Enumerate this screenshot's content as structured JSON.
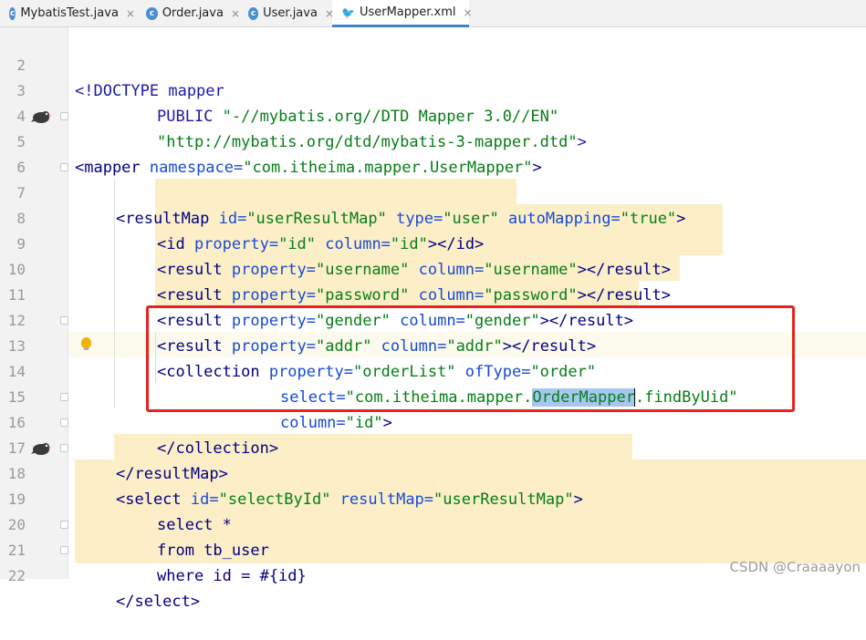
{
  "tabs": [
    {
      "label": "MybatisTest.java",
      "icon": "java-class-icon",
      "active": false
    },
    {
      "label": "Order.java",
      "icon": "java-class-icon",
      "active": false
    },
    {
      "label": "User.java",
      "icon": "java-class-icon",
      "active": false
    },
    {
      "label": "UserMapper.xml",
      "icon": "mybatis-xml-icon",
      "active": true
    }
  ],
  "close_glyph": "×",
  "line_numbers": [
    "2",
    "3",
    "4",
    "5",
    "6",
    "7",
    "8",
    "9",
    "10",
    "11",
    "12",
    "13",
    "14",
    "15",
    "16",
    "17",
    "18",
    "19",
    "20",
    "21",
    "22"
  ],
  "code": {
    "l2": {
      "open": "<!DOCTYPE mapper"
    },
    "l3": {
      "kw": "PUBLIC ",
      "val": "\"-//mybatis.org//DTD Mapper 3.0//EN\""
    },
    "l4": {
      "val": "\"http://mybatis.org/dtd/mybatis-3-mapper.dtd\"",
      "close": ">"
    },
    "l5": {
      "tag": "<mapper ",
      "a1": "namespace=",
      "v1": "\"com.itheima.mapper.UserMapper\"",
      "close": ">"
    },
    "l7": {
      "tag": "<resultMap ",
      "a1": "id=",
      "v1": "\"userResultMap\" ",
      "a2": "type=",
      "v2": "\"user\" ",
      "a3": "autoMapping=",
      "v3": "\"true\"",
      "close": ">"
    },
    "l8": {
      "tag": "<id ",
      "a1": "property=",
      "v1": "\"id\" ",
      "a2": "column=",
      "v2": "\"id\"",
      "close": "></id>"
    },
    "l9": {
      "tag": "<result ",
      "a1": "property=",
      "v1": "\"username\" ",
      "a2": "column=",
      "v2": "\"username\"",
      "close": "></result>"
    },
    "l10": {
      "tag": "<result ",
      "a1": "property=",
      "v1": "\"password\" ",
      "a2": "column=",
      "v2": "\"password\"",
      "close": "></result>"
    },
    "l11": {
      "tag": "<result ",
      "a1": "property=",
      "v1": "\"gender\" ",
      "a2": "column=",
      "v2": "\"gender\"",
      "close": "></result>"
    },
    "l12": {
      "tag": "<result ",
      "a1": "property=",
      "v1": "\"addr\" ",
      "a2": "column=",
      "v2": "\"addr\"",
      "close": "></result>"
    },
    "l13": {
      "tag": "<collection ",
      "a1": "property=",
      "v1": "\"orderList\" ",
      "a2": "ofType=",
      "v2": "\"order\""
    },
    "l14": {
      "a1": "select=",
      "v1a": "\"com.itheima.mapper.",
      "v1sel": "OrderMapper",
      "v1b": ".findByUid\""
    },
    "l15": {
      "a1": "column=",
      "v1": "\"id\"",
      "close": ">"
    },
    "l16": {
      "close": "</collection>"
    },
    "l17": {
      "close": "</resultMap>"
    },
    "l18": {
      "tag": "<select ",
      "a1": "id=",
      "v1": "\"selectById\" ",
      "a2": "resultMap=",
      "v2": "\"userResultMap\"",
      "close": ">"
    },
    "l19": {
      "text": "select *"
    },
    "l20": {
      "text": "from tb_user"
    },
    "l21": {
      "text": "where id = #{id}"
    },
    "l22": {
      "close": "</select>"
    }
  },
  "watermark": "CSDN @Craaaayon",
  "colors": {
    "tag": "#000080",
    "attribute": "#174ad4",
    "value": "#067d17",
    "highlight": "#fcefc8",
    "selection": "#a6c8f0",
    "annotation_box": "#e8231f"
  }
}
